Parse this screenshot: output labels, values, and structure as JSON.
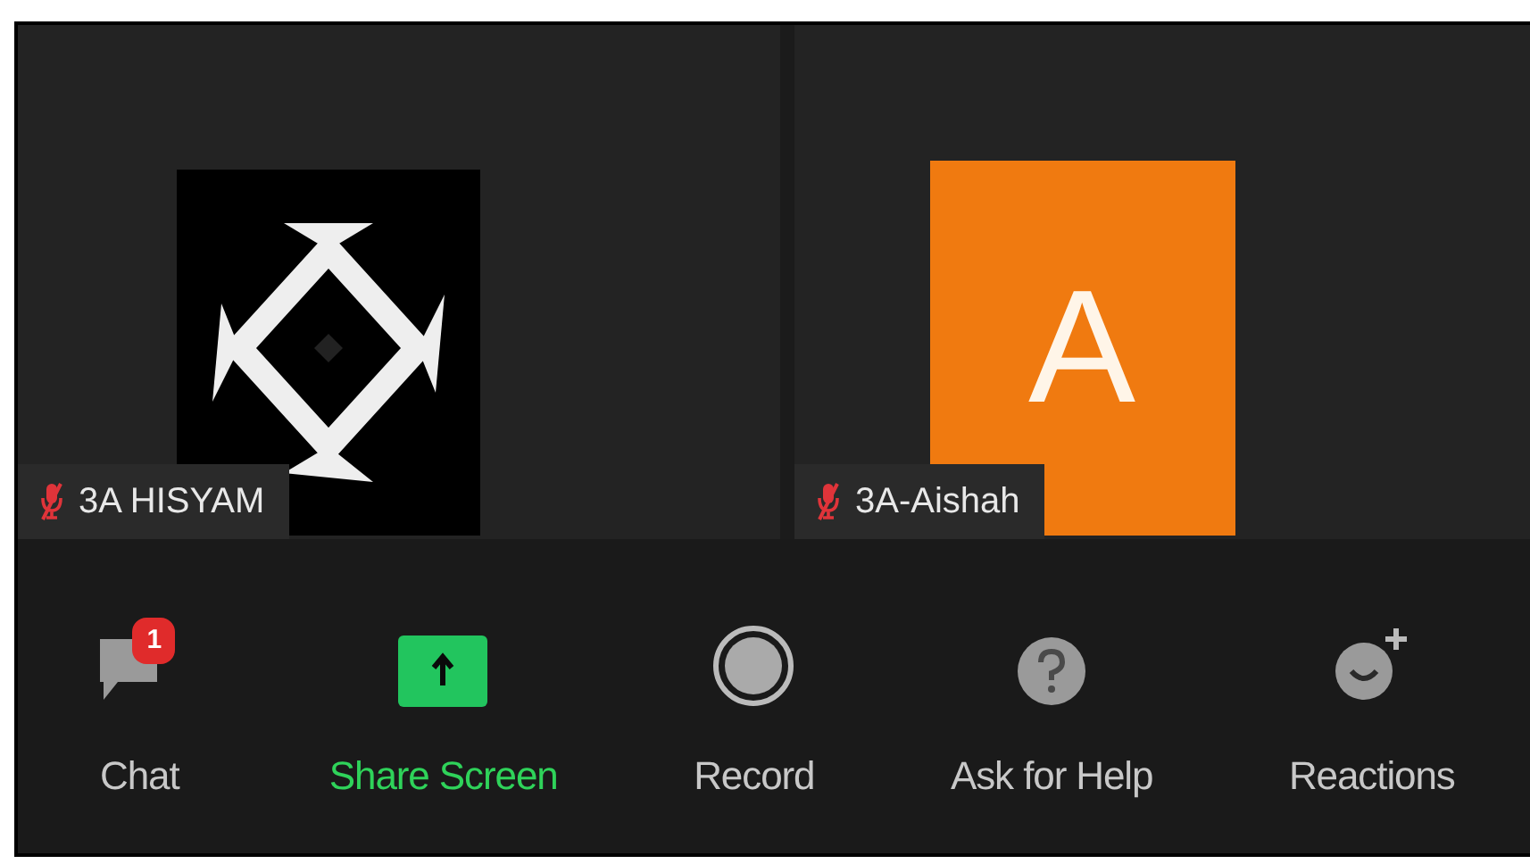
{
  "participants": [
    {
      "name": "3A HISYAM",
      "muted": true
    },
    {
      "name": "3A-Aishah",
      "muted": true,
      "avatar": {
        "kind": "initial",
        "initial": "A",
        "color": "#f07a10"
      }
    }
  ],
  "toolbar": [
    {
      "kind": "chat",
      "label": "Chat",
      "badge": "1",
      "highlighted": false
    },
    {
      "kind": "share",
      "label": "Share Screen",
      "highlighted": true
    },
    {
      "kind": "record",
      "label": "Record",
      "highlighted": false
    },
    {
      "kind": "help",
      "label": "Ask for Help",
      "highlighted": false
    },
    {
      "kind": "reactions",
      "label": "Reactions",
      "highlighted": false
    }
  ]
}
